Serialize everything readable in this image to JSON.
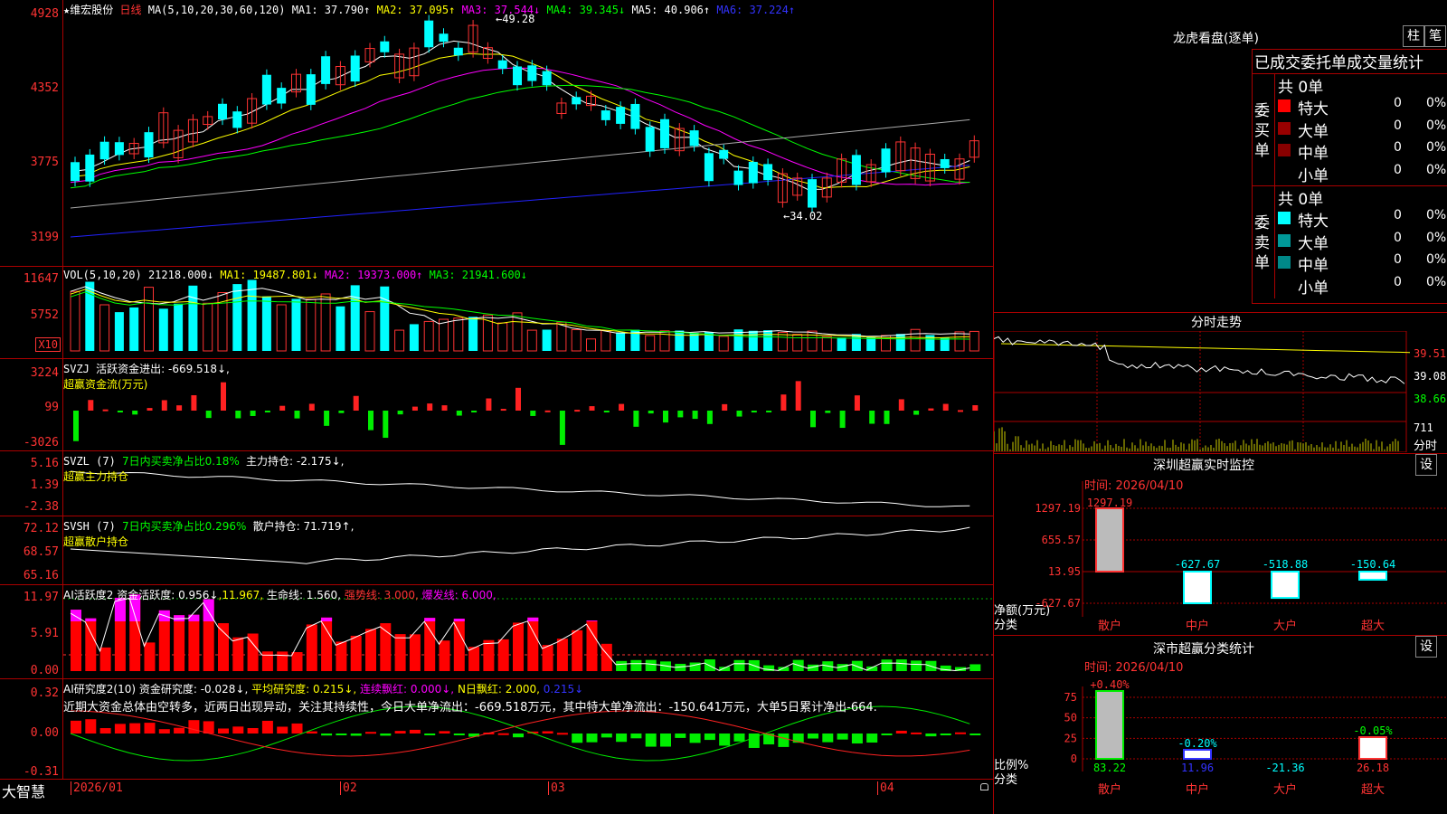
{
  "kline": {
    "title_star": "★",
    "stock_name": "维宏股份",
    "period": "日线",
    "ma_label": "MA(5,10,20,30,60,120)",
    "ma": [
      {
        "label": "MA1: 37.790↑",
        "color": "#ffffff"
      },
      {
        "label": "MA2: 37.095↑",
        "color": "#ffff00"
      },
      {
        "label": "MA3: 37.544↓",
        "color": "#ff00ff"
      },
      {
        "label": "MA4: 39.345↓",
        "color": "#00ff00"
      },
      {
        "label": "MA5: 40.906↑",
        "color": "#ffffff"
      },
      {
        "label": "MA6: 37.224↑",
        "color": "#3333ff"
      }
    ],
    "yticks": [
      "4928",
      "4352",
      "3775",
      "3199"
    ],
    "high_label": "49.28",
    "low_label": "34.02"
  },
  "vol": {
    "label": "VOL(5,10,20)",
    "value": "21218.000↓",
    "ma1": "MA1: 19487.801↓",
    "ma2": "MA2: 19373.000↑",
    "ma3": "MA3: 21941.600↓",
    "yticks": [
      "11647",
      "5752"
    ],
    "unit": "X10"
  },
  "svzj": {
    "label": "SVZJ",
    "title": "活跃资金进出: -669.518↓,",
    "sub": "超赢资金流(万元)",
    "yticks": [
      "3224",
      "99",
      "-3026"
    ]
  },
  "svzl": {
    "label": "SVZL (7)",
    "t1": "7日内买卖净占比0.18%",
    "t2": "主力持仓: -2.175↓,",
    "sub": "超赢主力持仓",
    "yticks": [
      "5.16",
      "1.39",
      "-2.38"
    ]
  },
  "svsh": {
    "label": "SVSH (7)",
    "t1": "7日内买卖净占比0.296%",
    "t2": "散户持仓: 71.719↑,",
    "sub": "超赢散户持仓",
    "yticks": [
      "72.12",
      "68.57",
      "65.16"
    ]
  },
  "ai1": {
    "label": "AI活跃度2",
    "t1": "资金活跃度: 0.956↓",
    "t2": ",11.967,",
    "t3": "生命线: 1.560,",
    "t4": "强势线: 3.000,",
    "t5": "爆发线: 6.000,",
    "yticks": [
      "11.97",
      "5.91",
      "0.00"
    ]
  },
  "ai2": {
    "label": "AI研究度2(10)",
    "t1": "资金研究度: -0.028↓,",
    "t2": "平均研究度: 0.215↓,",
    "t3": "连续飘红: 0.000↓,",
    "t4": "N日飘红: 2.000,",
    "t5": "0.215↓",
    "note": "近期大资金总体由空转多，近两日出现异动，关注其持续性，今日大单净流出：-669.518万元，其中特大单净流出：-150.641万元，大单5日累计净出-664.",
    "yticks": [
      "0.32",
      "0.00",
      "-0.31"
    ]
  },
  "dates": [
    "2026/01",
    "02",
    "03",
    "04"
  ],
  "brand": "大智慧",
  "lhb": {
    "title": "龙虎看盘(逐单)",
    "btn1": "柱",
    "btn2": "笔",
    "header": "已成交委托单成交量统计",
    "buy_side": "委买单",
    "sell_side": "委卖单",
    "buy_total": "共 0单",
    "sell_total": "共 0单",
    "buy_rows": [
      {
        "name": "特大",
        "count": "0",
        "pct": "0%",
        "color": "#ff0000"
      },
      {
        "name": "大单",
        "count": "0",
        "pct": "0%",
        "color": "#990000"
      },
      {
        "name": "中单",
        "count": "0",
        "pct": "0%",
        "color": "#880000"
      },
      {
        "name": "小单",
        "count": "0",
        "pct": "0%",
        "color": ""
      }
    ],
    "sell_rows": [
      {
        "name": "特大",
        "count": "0",
        "pct": "0%",
        "color": "#00ffff"
      },
      {
        "name": "大单",
        "count": "0",
        "pct": "0%",
        "color": "#009999"
      },
      {
        "name": "中单",
        "count": "0",
        "pct": "0%",
        "color": "#008888"
      },
      {
        "name": "小单",
        "count": "0",
        "pct": "0%",
        "color": ""
      }
    ]
  },
  "intraday": {
    "title": "分时走势",
    "prices": [
      "39.51",
      "39.08",
      "38.66"
    ],
    "vol": "711",
    "vol_unit": "分时"
  },
  "monitor": {
    "title": "深圳超赢实时监控",
    "btn": "设",
    "time": "时间: 2026/04/10",
    "yticks": [
      "1297.19",
      "655.57",
      "13.95",
      "-627.67"
    ],
    "ylabel1": "净额(万元)",
    "ylabel2": "分类",
    "bars": [
      {
        "cat": "散户",
        "value": "1297.19"
      },
      {
        "cat": "中户",
        "value": "-627.67"
      },
      {
        "cat": "大户",
        "value": "-518.88"
      },
      {
        "cat": "超大",
        "value": "-150.64"
      }
    ]
  },
  "classify": {
    "title": "深市超赢分类统计",
    "btn": "设",
    "time": "时间: 2026/04/10",
    "yticks": [
      "75",
      "50",
      "25",
      "0"
    ],
    "ylabel1": "比例%",
    "ylabel2": "分类",
    "bars": [
      {
        "cat": "散户",
        "top": "+0.40%",
        "bottom": "83.22"
      },
      {
        "cat": "中户",
        "top": "-0.20%",
        "bottom": "11.96"
      },
      {
        "cat": "大户",
        "top": "",
        "bottom": "-21.36"
      },
      {
        "cat": "超大",
        "top": "-0.05%",
        "bottom": "26.18"
      }
    ]
  }
}
